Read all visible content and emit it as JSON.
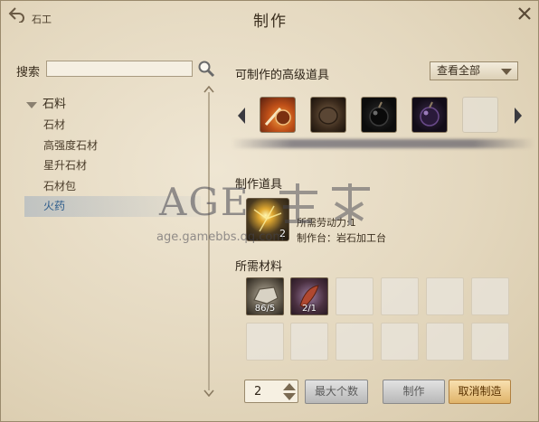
{
  "header": {
    "back_label": "石工",
    "title": "制作"
  },
  "search": {
    "label": "搜索",
    "value": "",
    "placeholder": ""
  },
  "category_tree": {
    "category": "石料",
    "items": [
      {
        "label": "石材",
        "selected": false
      },
      {
        "label": "高强度石材",
        "selected": false
      },
      {
        "label": "星升石材",
        "selected": false
      },
      {
        "label": "石材包",
        "selected": false
      },
      {
        "label": "火药",
        "selected": true
      }
    ]
  },
  "advanced_items": {
    "title": "可制作的高级道具",
    "filter": "查看全部",
    "slots": [
      {
        "icon": "fire-bomb-icon"
      },
      {
        "icon": "dark-ore-icon"
      },
      {
        "icon": "black-bomb-icon"
      },
      {
        "icon": "purple-bomb-icon"
      },
      {
        "icon": "empty"
      }
    ]
  },
  "production": {
    "title": "制作道具",
    "icon": "gunpowder-icon",
    "count": "2",
    "requirement": "所需劳动力:1",
    "workbench": "制作台：岩石加工台"
  },
  "materials": {
    "title": "所需材料",
    "slots": [
      {
        "icon": "stone-material-icon",
        "count": "86/5"
      },
      {
        "icon": "red-powder-icon",
        "count": "2/1"
      }
    ]
  },
  "controls": {
    "quantity": "2",
    "max_label": "最大个数",
    "craft_label": "制作",
    "cancel_label": "取消制造"
  },
  "watermark": {
    "logo": "AGE",
    "subtitle": "age.gamebbs.qq.com"
  },
  "colors": {
    "panel_bg": "#e8dcc4",
    "selected_text": "#2a5a8a",
    "primary_button": "#e8c07a"
  }
}
